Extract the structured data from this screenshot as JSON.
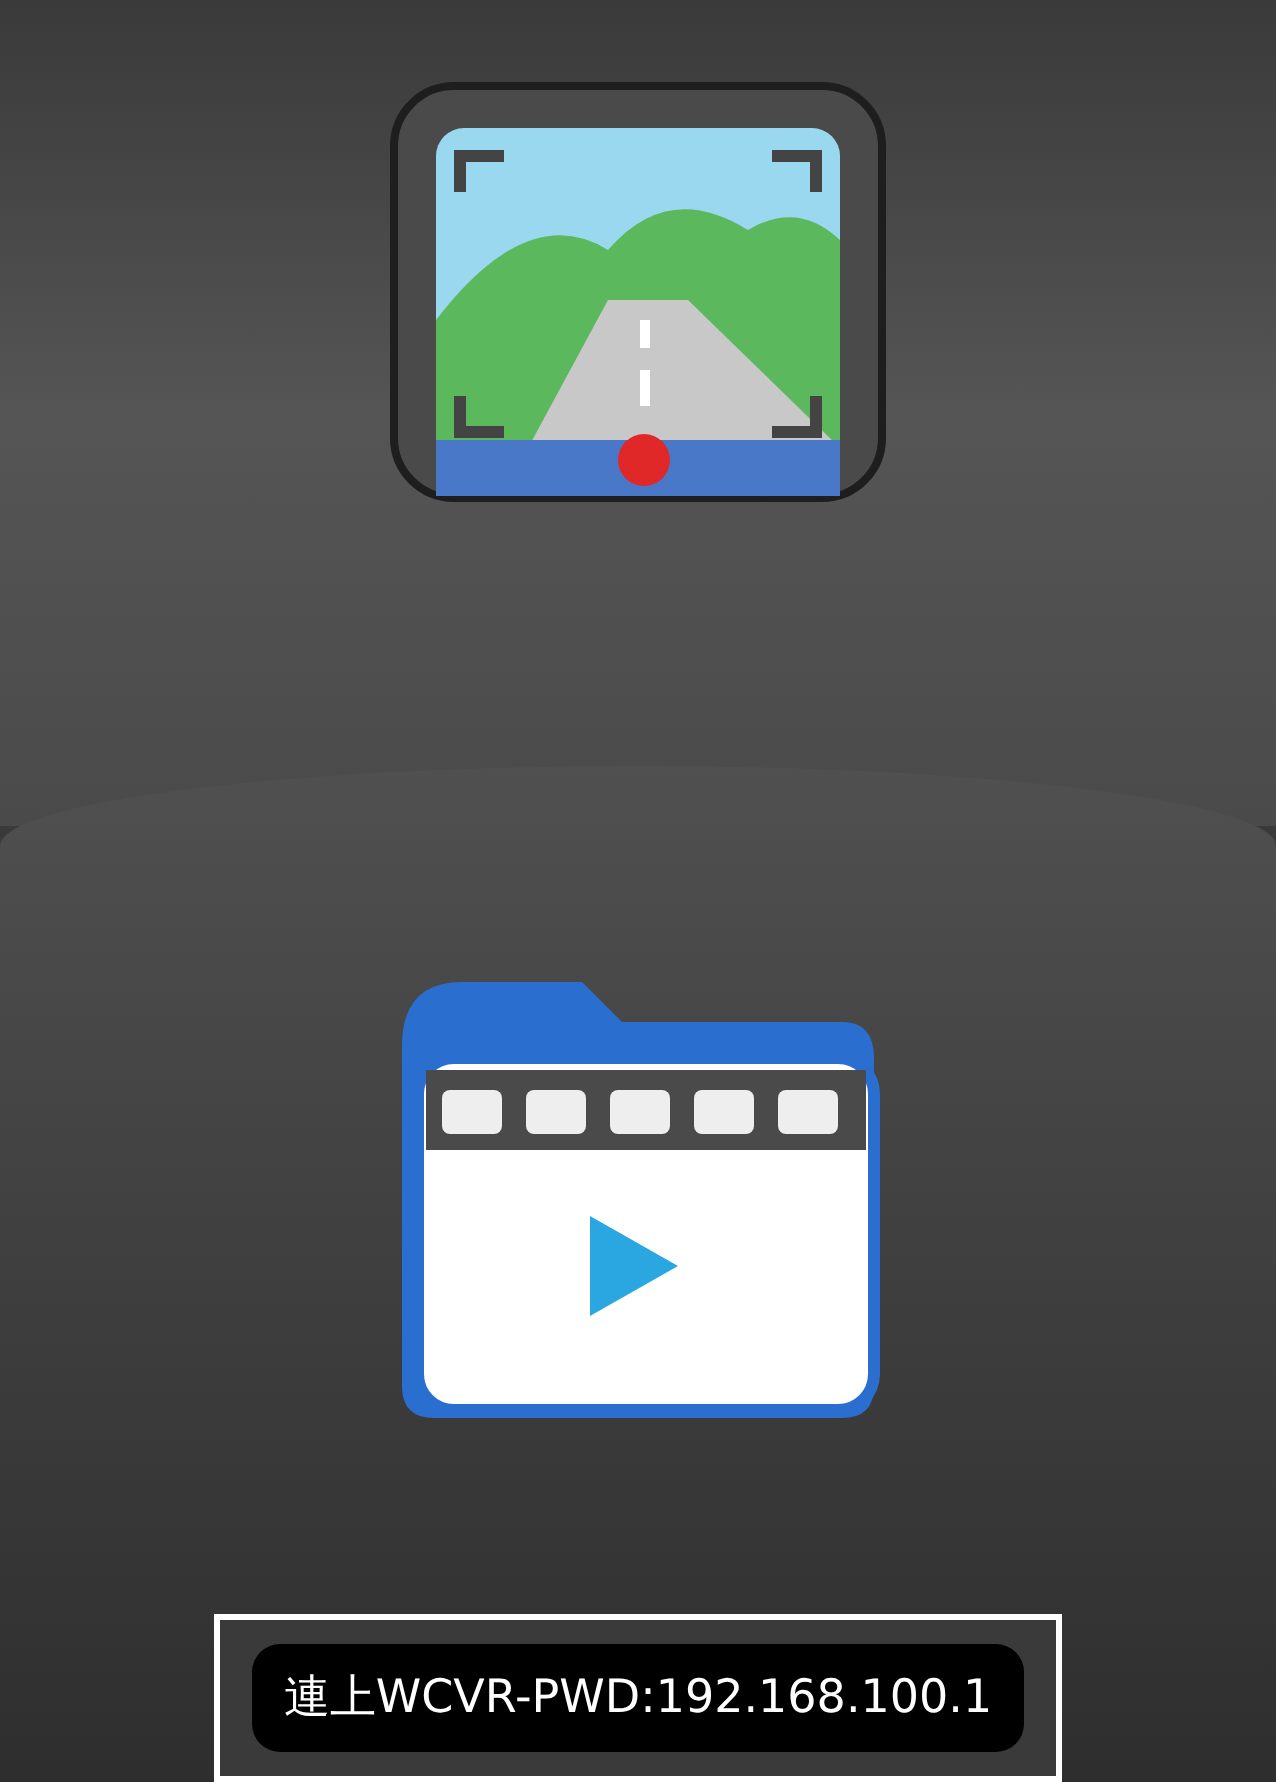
{
  "toast": {
    "text": "連上WCVR-PWD:192.168.100.1"
  }
}
